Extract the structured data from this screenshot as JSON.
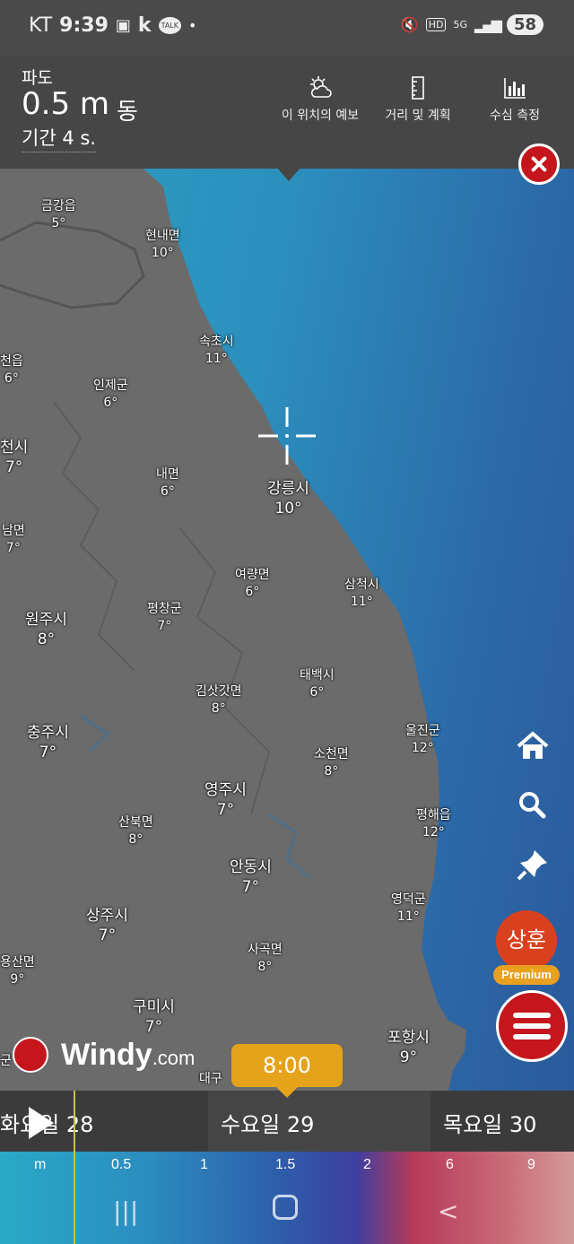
{
  "status": {
    "carrier": "KT",
    "time": "9:39",
    "k": "k",
    "talk": "TALK",
    "dot": "•",
    "hd": "HD",
    "net": "5G",
    "battery": "58"
  },
  "header": {
    "label": "파도",
    "value": "0.5 m",
    "direction": "동",
    "period": "기간 4 s.",
    "buttons": [
      {
        "label": "이 위치의 예보",
        "icon": "cloud-sun-icon"
      },
      {
        "label": "거리 및 계획",
        "icon": "ruler-icon"
      },
      {
        "label": "수심 측정",
        "icon": "bar-chart-icon"
      }
    ]
  },
  "map": {
    "cities": [
      {
        "name": "금강읍",
        "temp": "5°"
      },
      {
        "name": "현내면",
        "temp": "10°"
      },
      {
        "name": "속초시",
        "temp": "11°"
      },
      {
        "name": "천읍",
        "temp": "6°"
      },
      {
        "name": "인제군",
        "temp": "6°"
      },
      {
        "name": "천시",
        "temp": "7°"
      },
      {
        "name": "내면",
        "temp": "6°"
      },
      {
        "name": "강릉시",
        "temp": "10°"
      },
      {
        "name": "남면",
        "temp": "7°"
      },
      {
        "name": "여량면",
        "temp": "6°"
      },
      {
        "name": "삼척시",
        "temp": "11°"
      },
      {
        "name": "원주시",
        "temp": "8°"
      },
      {
        "name": "평창군",
        "temp": "7°"
      },
      {
        "name": "태백시",
        "temp": "6°"
      },
      {
        "name": "김삿갓면",
        "temp": "8°"
      },
      {
        "name": "충주시",
        "temp": "7°"
      },
      {
        "name": "울진군",
        "temp": "12°"
      },
      {
        "name": "소천면",
        "temp": "8°"
      },
      {
        "name": "영주시",
        "temp": "7°"
      },
      {
        "name": "평해읍",
        "temp": "12°"
      },
      {
        "name": "산북면",
        "temp": "8°"
      },
      {
        "name": "안동시",
        "temp": "7°"
      },
      {
        "name": "영덕군",
        "temp": "11°"
      },
      {
        "name": "상주시",
        "temp": "7°"
      },
      {
        "name": "사곡면",
        "temp": "8°"
      },
      {
        "name": "용산면",
        "temp": "9°"
      },
      {
        "name": "구미시",
        "temp": "7°"
      },
      {
        "name": "포항시",
        "temp": "9°"
      },
      {
        "name": "군",
        "temp": ""
      },
      {
        "name": "대구",
        "temp": ""
      }
    ]
  },
  "user": {
    "initials": "상훈",
    "badge": "Premium"
  },
  "brand": {
    "name": "Windy",
    "suffix": ".com"
  },
  "timeline": {
    "current_time": "8:00",
    "days": [
      "화요일 28",
      "수요일 29",
      "목요일 30"
    ]
  },
  "legend": {
    "unit": "m",
    "ticks": [
      "0.5",
      "1",
      "1.5",
      "2",
      "6",
      "9"
    ]
  },
  "colors": {
    "accent": "#c4161c",
    "time_bubble": "#e5a21b",
    "sea": "#2c8fbd",
    "land": "#6b6b6b"
  }
}
